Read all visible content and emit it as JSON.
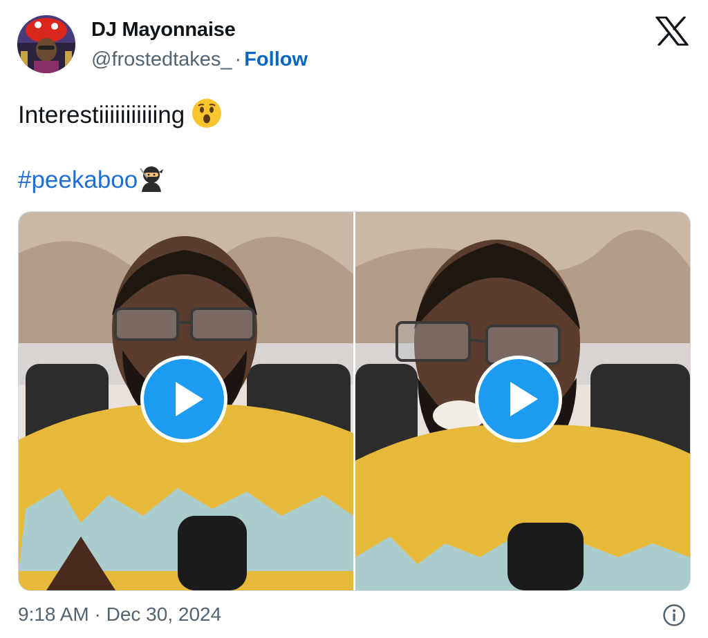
{
  "author": {
    "display_name": "DJ Mayonnaise",
    "handle": "@frostedtakes_",
    "separator": "·",
    "follow_label": "Follow"
  },
  "tweet": {
    "text": "Interestiiiiiiiiiiing",
    "text_emoji": "astonished-face-icon",
    "hashtag": "#peekaboo",
    "hashtag_emoji": "ninja-icon"
  },
  "media": {
    "videos": [
      {
        "label": "video-1",
        "play_icon": "play-icon"
      },
      {
        "label": "video-2",
        "play_icon": "play-icon"
      }
    ]
  },
  "footer": {
    "timestamp": "9:18 AM · Dec 30, 2024",
    "info_icon": "info-icon"
  },
  "colors": {
    "follow": "#0a66c2",
    "hashtag": "#1d6fd6",
    "play_button": "#1d9bf0",
    "muted_text": "#536471",
    "shirt": "#e6b93a"
  }
}
